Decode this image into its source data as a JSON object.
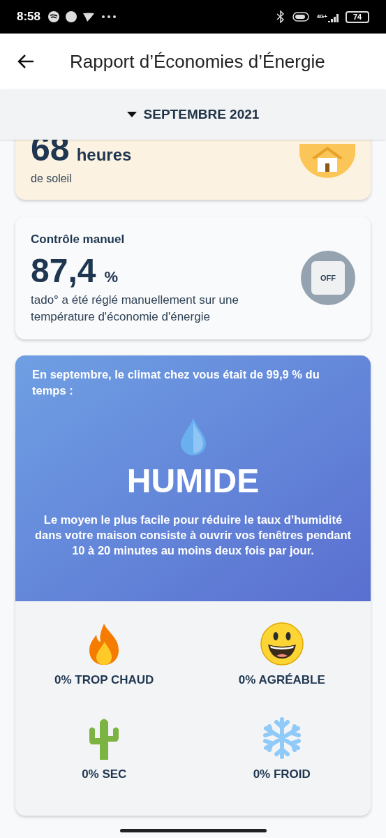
{
  "status_bar": {
    "time": "8:58",
    "network": "4G+",
    "battery": "74"
  },
  "header": {
    "title": "Rapport d’Économies d’Énergie"
  },
  "month_selector": {
    "label": "SEPTEMBRE 2021",
    "expanded": false
  },
  "sun_card": {
    "value": "68",
    "unit": "heures",
    "caption": "de soleil"
  },
  "manual_card": {
    "title": "Contrôle manuel",
    "value": "87,4",
    "unit": "%",
    "description": "tado° a été réglé manuellement sur une température d'économie d'énergie",
    "badge": "OFF"
  },
  "climate_card": {
    "intro": "En septembre, le climat chez vous était de 99,9 % du temps :",
    "state": "HUMIDE",
    "advice": "Le moyen le plus facile pour réduire le taux d’humidité dans votre maison consiste à ouvrir vos fenêtres pendant 10 à 20 minutes au moins deux fois par jour.",
    "categories": [
      {
        "kind": "hot",
        "label": "0% TROP CHAUD"
      },
      {
        "kind": "pleasant",
        "label": "0% AGRÉABLE"
      },
      {
        "kind": "dry",
        "label": "0% SEC"
      },
      {
        "kind": "cold",
        "label": "0% FROID"
      }
    ]
  }
}
